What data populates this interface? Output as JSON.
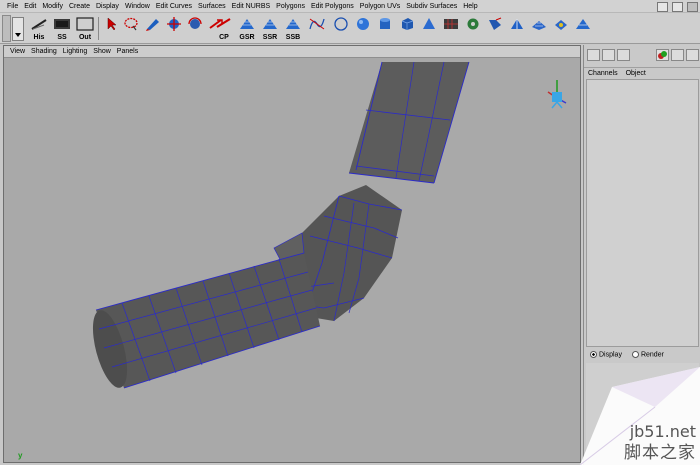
{
  "menubar": {
    "items": [
      "File",
      "Edit",
      "Modify",
      "Create",
      "Display",
      "Window",
      "Edit Curves",
      "Surfaces",
      "Edit NURBS",
      "Polygons",
      "Edit Polygons",
      "Polygon UVs",
      "Subdiv Surfaces",
      "Help"
    ]
  },
  "shelf": {
    "tools": [
      {
        "name": "history-tool",
        "label": "His"
      },
      {
        "name": "ss-tool",
        "label": "SS"
      },
      {
        "name": "out-tool",
        "label": "Out"
      },
      {
        "name": "select-tool",
        "label": ""
      },
      {
        "name": "lasso-tool",
        "label": ""
      },
      {
        "name": "paint-tool",
        "label": ""
      },
      {
        "name": "move-tool",
        "label": ""
      },
      {
        "name": "rotate-tool",
        "label": ""
      },
      {
        "name": "cp-tool",
        "label": "CP"
      },
      {
        "name": "gsr-tool",
        "label": "GSR"
      },
      {
        "name": "ssr-tool",
        "label": "SSR"
      },
      {
        "name": "ssb-tool",
        "label": "SSB"
      },
      {
        "name": "curve-tool",
        "label": ""
      },
      {
        "name": "sphere-tool",
        "label": ""
      },
      {
        "name": "cylinder-tool",
        "label": ""
      }
    ]
  },
  "viewport": {
    "panel_menu": [
      "View",
      "Shading",
      "Lighting",
      "Show",
      "Panels"
    ],
    "axis_indicator": "y"
  },
  "channel_box": {
    "tabs": [
      "Channels",
      "Object"
    ],
    "footer": {
      "display_label": "Display",
      "render_label": "Render",
      "selected": "Display"
    }
  },
  "watermark": {
    "url": "jb51.net",
    "site": "脚本之家"
  },
  "colors": {
    "viewport_bg": "#a9a9a9",
    "mesh_fill": "#5a5a5a",
    "wireframe": "#2b2bc8",
    "ui_bg": "#cfcfcf"
  }
}
